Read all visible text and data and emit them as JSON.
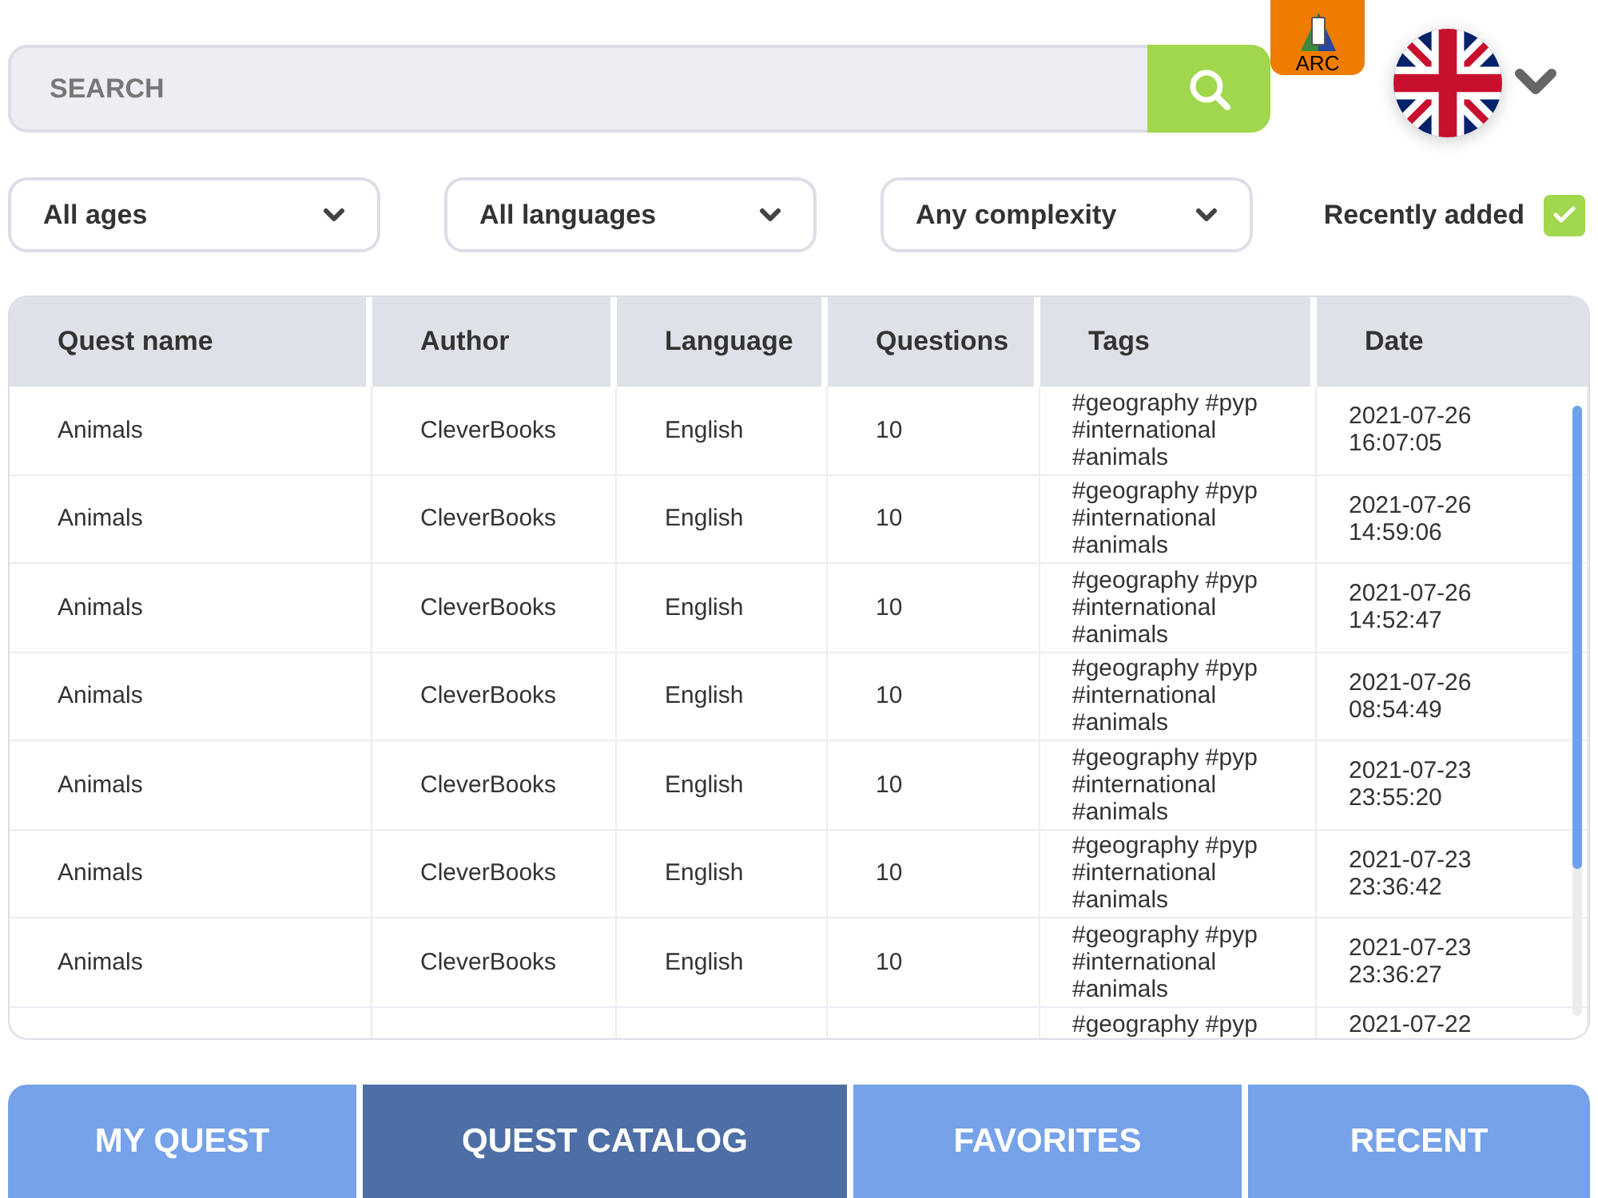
{
  "search": {
    "placeholder": "SEARCH"
  },
  "logo": {
    "text": "ARC"
  },
  "filters": [
    {
      "kind": "dropdown",
      "label": "All ages"
    },
    {
      "kind": "dropdown",
      "label": "All languages"
    },
    {
      "kind": "dropdown",
      "label": "Any complexity"
    },
    {
      "kind": "checkbox",
      "label": "Recently added",
      "checked": true
    }
  ],
  "table": {
    "columns": [
      "Quest name",
      "Author",
      "Language",
      "Questions",
      "Tags",
      "Date"
    ],
    "rows": [
      {
        "cells": [
          "Animals",
          "CleverBooks",
          "English",
          "10",
          "#geography #pyp #international #animals",
          "2021-07-26 16:07:05"
        ]
      },
      {
        "cells": [
          "Animals",
          "CleverBooks",
          "English",
          "10",
          "#geography #pyp #international #animals",
          "2021-07-26 14:59:06"
        ]
      },
      {
        "cells": [
          "Animals",
          "CleverBooks",
          "English",
          "10",
          "#geography #pyp #international #animals",
          "2021-07-26 14:52:47"
        ]
      },
      {
        "cells": [
          "Animals",
          "CleverBooks",
          "English",
          "10",
          "#geography #pyp #international #animals",
          "2021-07-26 08:54:49"
        ]
      },
      {
        "cells": [
          "Animals",
          "CleverBooks",
          "English",
          "10",
          "#geography #pyp #international #animals",
          "2021-07-23 23:55:20"
        ]
      },
      {
        "cells": [
          "Animals",
          "CleverBooks",
          "English",
          "10",
          "#geography #pyp #international #animals",
          "2021-07-23 23:36:42"
        ]
      },
      {
        "cells": [
          "Animals",
          "CleverBooks",
          "English",
          "10",
          "#geography #pyp #international #animals",
          "2021-07-23 23:36:27"
        ]
      },
      {
        "cells": [
          "",
          "",
          "",
          "",
          "#geography #pyp",
          "2021-07-22"
        ]
      }
    ]
  },
  "tabs": [
    {
      "label": "MY QUEST",
      "selected": false
    },
    {
      "label": "QUEST CATALOG",
      "selected": true
    },
    {
      "label": "FAVORITES",
      "selected": false
    },
    {
      "label": "RECENT",
      "selected": false
    }
  ]
}
